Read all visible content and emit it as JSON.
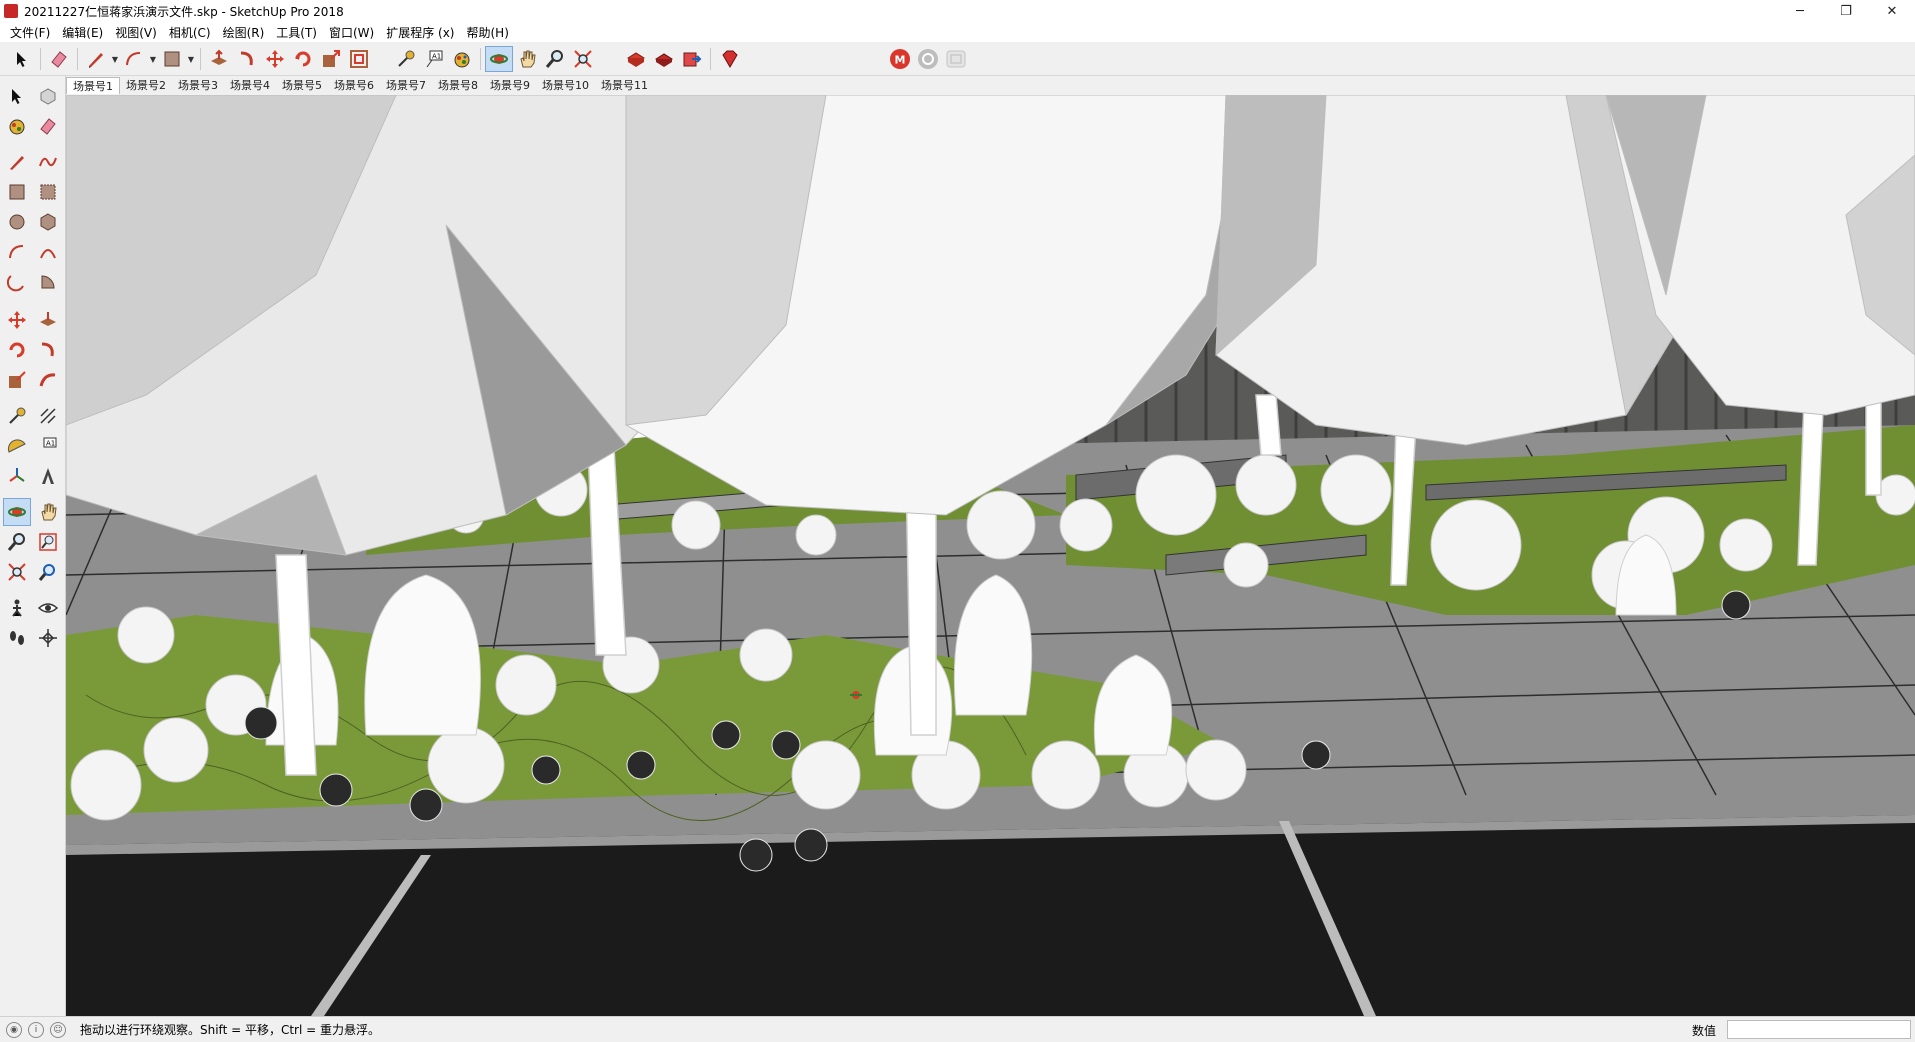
{
  "window": {
    "title": "20211227仁恒蒋家浜演示文件.skp - SketchUp Pro 2018",
    "minimize": "─",
    "maximize": "❐",
    "close": "✕"
  },
  "menu": [
    "文件(F)",
    "编辑(E)",
    "视图(V)",
    "相机(C)",
    "绘图(R)",
    "工具(T)",
    "窗口(W)",
    "扩展程序 (x)",
    "帮助(H)"
  ],
  "scenes": [
    "场景号1",
    "场景号2",
    "场景号3",
    "场景号4",
    "场景号5",
    "场景号6",
    "场景号7",
    "场景号8",
    "场景号9",
    "场景号10",
    "场景号11"
  ],
  "status": {
    "message": "拖动以进行环绕观察。Shift = 平移，Ctrl = 重力悬浮。",
    "vcb_label": "数值",
    "vcb_value": ""
  },
  "colors": {
    "grass": "#7a9a3a",
    "paving": "#8f8f8f",
    "road": "#1b1b1b",
    "accent_red": "#d83b2a"
  }
}
